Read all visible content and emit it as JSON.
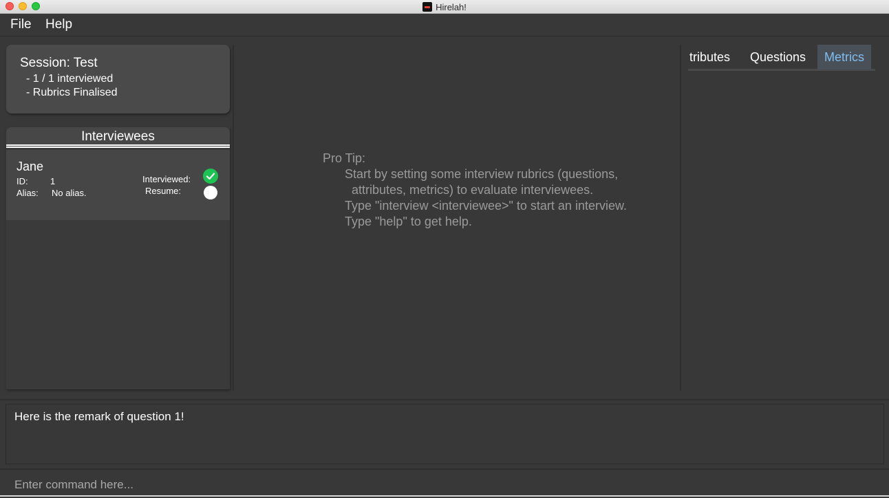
{
  "window": {
    "title": "Hirelah!",
    "app_icon": "hirelah-app-icon"
  },
  "menu": {
    "items": [
      "File",
      "Help"
    ]
  },
  "session": {
    "title": "Session: Test",
    "progress": "- 1 / 1 interviewed",
    "rubrics": "- Rubrics Finalised"
  },
  "interviewees": {
    "header": "Interviewees",
    "items": [
      {
        "name": "Jane",
        "id_label": "ID:",
        "id_value": "1",
        "alias_label": "Alias:",
        "alias_value": "No alias.",
        "interviewed_label": "Interviewed:",
        "interviewed": true,
        "resume_label": "Resume:",
        "resume": false
      }
    ]
  },
  "tip": {
    "heading": "Pro Tip:",
    "lines": [
      "Start by setting some interview rubrics (questions,",
      "attributes, metrics) to evaluate interviewees.",
      "Type \"interview <interviewee>\" to start an interview.",
      "Type \"help\" to get help."
    ]
  },
  "tabs": {
    "items": [
      "tributes",
      "Questions",
      "Metrics"
    ],
    "selected": "Metrics"
  },
  "result": {
    "text": "Here is the remark of question 1!"
  },
  "command": {
    "placeholder": "Enter command here...",
    "value": ""
  },
  "colors": {
    "background": "#383838",
    "accent": "#7fbef0",
    "success": "#1ec253",
    "tip_text": "#9a9a9a"
  }
}
